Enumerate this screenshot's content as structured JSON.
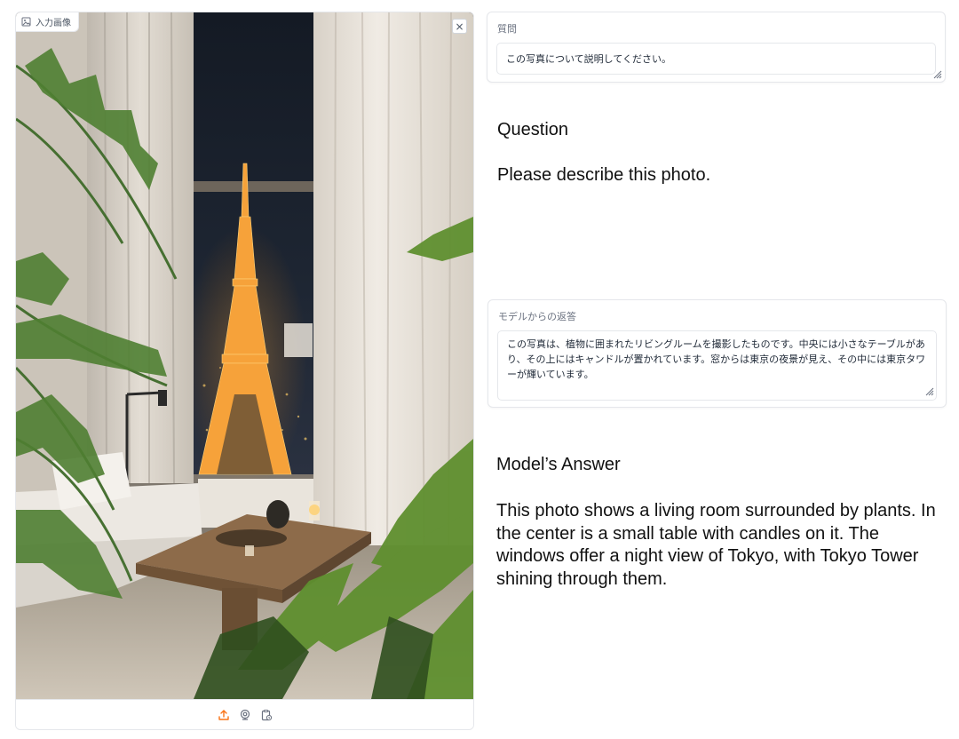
{
  "image_panel": {
    "label": "入力画像",
    "label_icon": "image-icon",
    "close_label": "×",
    "toolbar_icons": [
      "upload-icon",
      "webcam-icon",
      "clipboard-icon"
    ],
    "accent": "#f97316"
  },
  "question": {
    "label": "質問",
    "value": "この写真について説明してください。"
  },
  "answer": {
    "label": "モデルからの返答",
    "value": "この写真は、植物に囲まれたリビングルームを撮影したものです。中央には小さなテーブルがあり、その上にはキャンドルが置かれています。窓からは東京の夜景が見え、その中には東京タワーが輝いています。"
  },
  "captions": {
    "question_heading": "Question",
    "question_text": "Please describe this photo.",
    "answer_heading": "Model’s Answer",
    "answer_text": "This photo shows a living room surrounded by plants. In the center is a small table with candles on it. The windows offer a night view of Tokyo, with Tokyo Tower shining through them."
  }
}
